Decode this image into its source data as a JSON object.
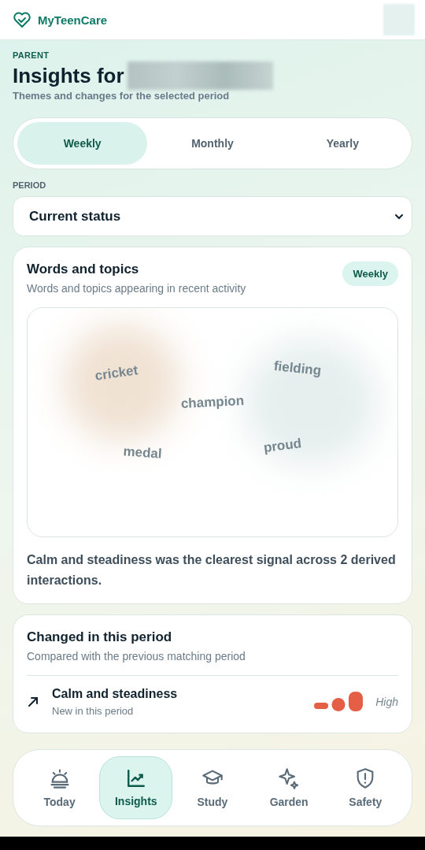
{
  "app": {
    "name": "MyTeenCare"
  },
  "header": {
    "eyebrow": "PARENT",
    "title": "Insights for",
    "subtitle": "Themes and changes for the selected period"
  },
  "tabs": [
    {
      "label": "Weekly",
      "selected": true
    },
    {
      "label": "Monthly",
      "selected": false
    },
    {
      "label": "Yearly",
      "selected": false
    }
  ],
  "period": {
    "label": "PERIOD",
    "value": "Current status"
  },
  "words_card": {
    "title": "Words and topics",
    "subtitle": "Words and topics appearing in recent activity",
    "badge": "Weekly",
    "words": [
      "cricket",
      "fielding",
      "champion",
      "medal",
      "proud"
    ],
    "summary": "Calm and steadiness was the clearest signal across 2 derived interactions."
  },
  "changes_card": {
    "title": "Changed in this period",
    "subtitle": "Compared with the previous matching period",
    "items": [
      {
        "name": "Calm and steadiness",
        "note": "New in this period",
        "intensity": "High"
      }
    ]
  },
  "nav": [
    {
      "label": "Today",
      "kind": "sunrise",
      "selected": false
    },
    {
      "label": "Insights",
      "kind": "chart",
      "selected": true
    },
    {
      "label": "Study",
      "kind": "cap",
      "selected": false
    },
    {
      "label": "Garden",
      "kind": "sparkle",
      "selected": false
    },
    {
      "label": "Safety",
      "kind": "shield",
      "selected": false
    }
  ]
}
